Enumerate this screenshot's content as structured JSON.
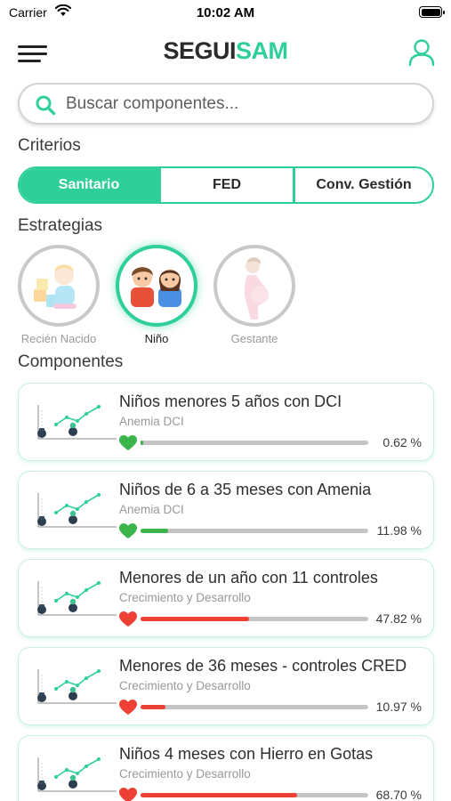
{
  "status_bar": {
    "carrier": "Carrier",
    "time": "10:02 AM"
  },
  "header": {
    "brand_part1": "SEGUI",
    "brand_part2": "SAM"
  },
  "search": {
    "placeholder": "Buscar componentes..."
  },
  "criteria": {
    "title": "Criterios",
    "options": [
      "Sanitario",
      "FED",
      "Conv. Gestión"
    ],
    "selected": "Sanitario"
  },
  "strategies": {
    "title": "Estrategias",
    "items": [
      {
        "label": "Recién Nacido",
        "icon": "newborn-icon",
        "active": false
      },
      {
        "label": "Niño",
        "icon": "children-icon",
        "active": true
      },
      {
        "label": "Gestante",
        "icon": "pregnant-icon",
        "active": false
      }
    ]
  },
  "components": {
    "title": "Componentes",
    "items": [
      {
        "title": "Niños  menores 5 años con DCI",
        "subtitle": "Anemia DCI",
        "percent_label": "0.62 %",
        "progress": 0.0062,
        "status": "good"
      },
      {
        "title": "Niños de 6 a 35 meses con Amenia",
        "subtitle": "Anemia DCI",
        "percent_label": "11.98 %",
        "progress": 0.1198,
        "status": "good"
      },
      {
        "title": "Menores de un año con 11 controles",
        "subtitle": "Crecimiento y Desarrollo",
        "percent_label": "47.82 %",
        "progress": 0.4782,
        "status": "bad"
      },
      {
        "title": "Menores de 36 meses - controles CRED",
        "subtitle": "Crecimiento y Desarrollo",
        "percent_label": "10.97 %",
        "progress": 0.1097,
        "status": "bad"
      },
      {
        "title": "Niños 4 meses con Hierro en Gotas",
        "subtitle": "Crecimiento y Desarrollo",
        "percent_label": "68.70 %",
        "progress": 0.687,
        "status": "bad"
      }
    ]
  },
  "colors": {
    "accent": "#2ecf98",
    "good": "#3bb54a",
    "bad": "#ee4035",
    "track": "#c5c5c5"
  }
}
